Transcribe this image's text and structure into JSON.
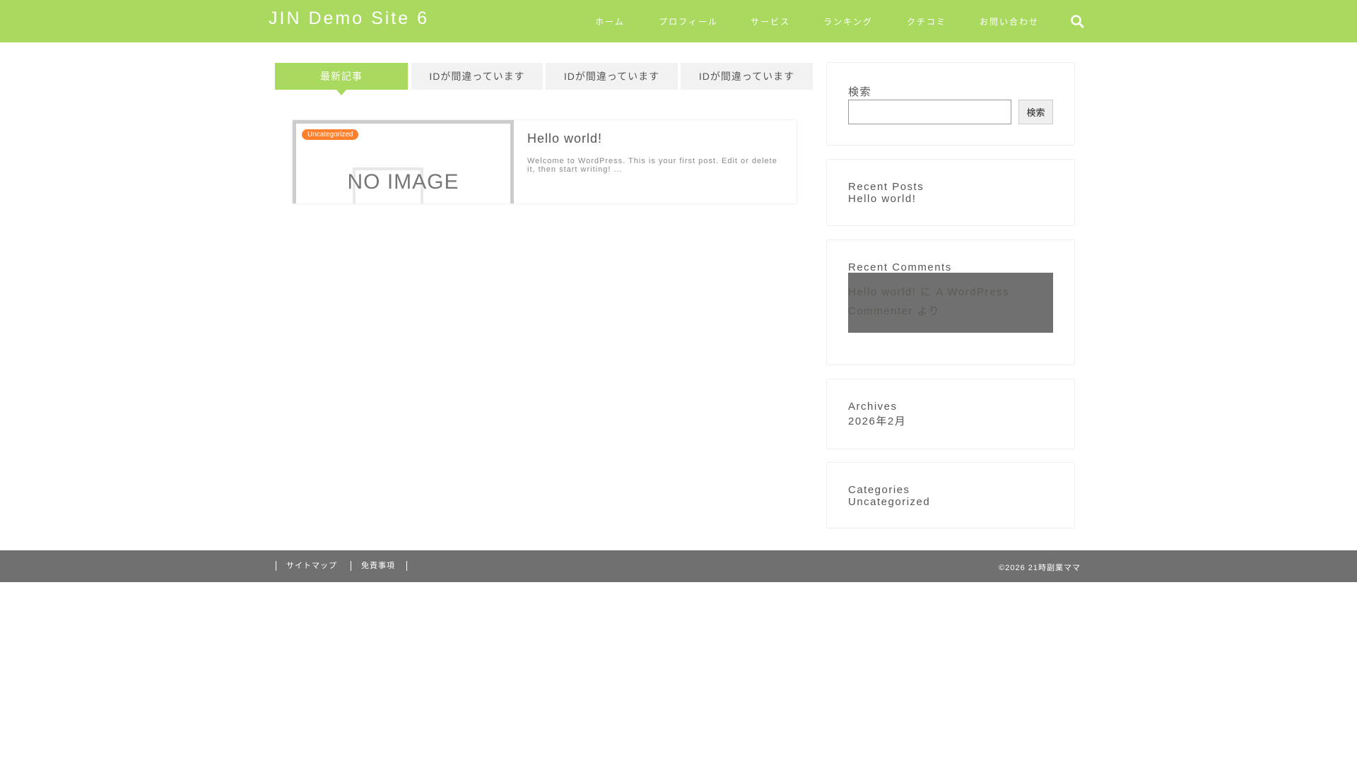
{
  "header": {
    "site_title": "JIN Demo Site 6",
    "nav": [
      "ホーム",
      "プロフィール",
      "サービス",
      "ランキング",
      "クチコミ",
      "お問い合わせ"
    ],
    "search_icon": "search-icon",
    "bg_color": "#a9da5f"
  },
  "tabs": [
    "最新記事",
    "IDが間違っています",
    "IDが間違っています",
    "IDが間違っています"
  ],
  "post": {
    "category": "Uncategorized",
    "thumb_text": "NO IMAGE",
    "title": "Hello world!",
    "excerpt": "Welcome to WordPress. This is your first post. Edit or delete it, then start writing!  ..."
  },
  "sidebar": {
    "search": {
      "title": "検索",
      "placeholder": "",
      "button": "検索"
    },
    "recent_posts": {
      "title": "Recent Posts",
      "items": [
        "Hello world!"
      ]
    },
    "recent_comments": {
      "title": "Recent Comments",
      "line1": "Hello world! に A WordPress",
      "line2": "Commenter より"
    },
    "archives": {
      "title": "Archives",
      "items": [
        "2026年2月"
      ]
    },
    "categories": {
      "title": "Categories",
      "items": [
        "Uncategorized"
      ]
    }
  },
  "footer": {
    "links": [
      "サイトマップ",
      "免責事項"
    ],
    "copyright": "©2026  21時副業ママ"
  }
}
